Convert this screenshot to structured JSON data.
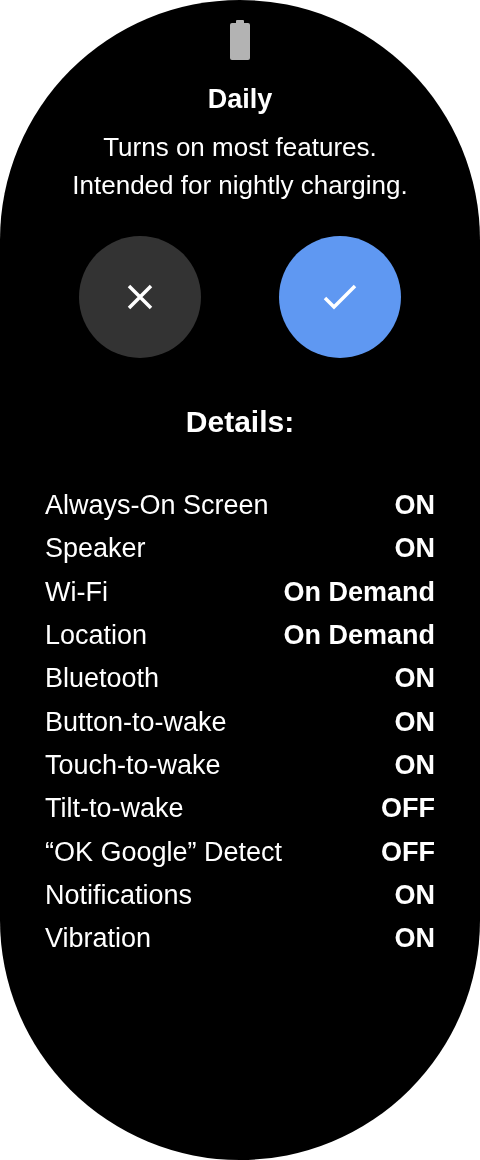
{
  "title": "Daily",
  "description": "Turns on most features. Intended for nightly charging.",
  "details_heading": "Details:",
  "details": [
    {
      "label": "Always-On Screen",
      "value": "ON"
    },
    {
      "label": "Speaker",
      "value": "ON"
    },
    {
      "label": "Wi-Fi",
      "value": "On Demand"
    },
    {
      "label": "Location",
      "value": "On Demand"
    },
    {
      "label": "Bluetooth",
      "value": "ON"
    },
    {
      "label": "Button-to-wake",
      "value": "ON"
    },
    {
      "label": "Touch-to-wake",
      "value": "ON"
    },
    {
      "label": "Tilt-to-wake",
      "value": "OFF"
    },
    {
      "label": "“OK Google” Detect",
      "value": "OFF"
    },
    {
      "label": "Notifications",
      "value": "ON"
    },
    {
      "label": "Vibration",
      "value": "ON"
    }
  ]
}
